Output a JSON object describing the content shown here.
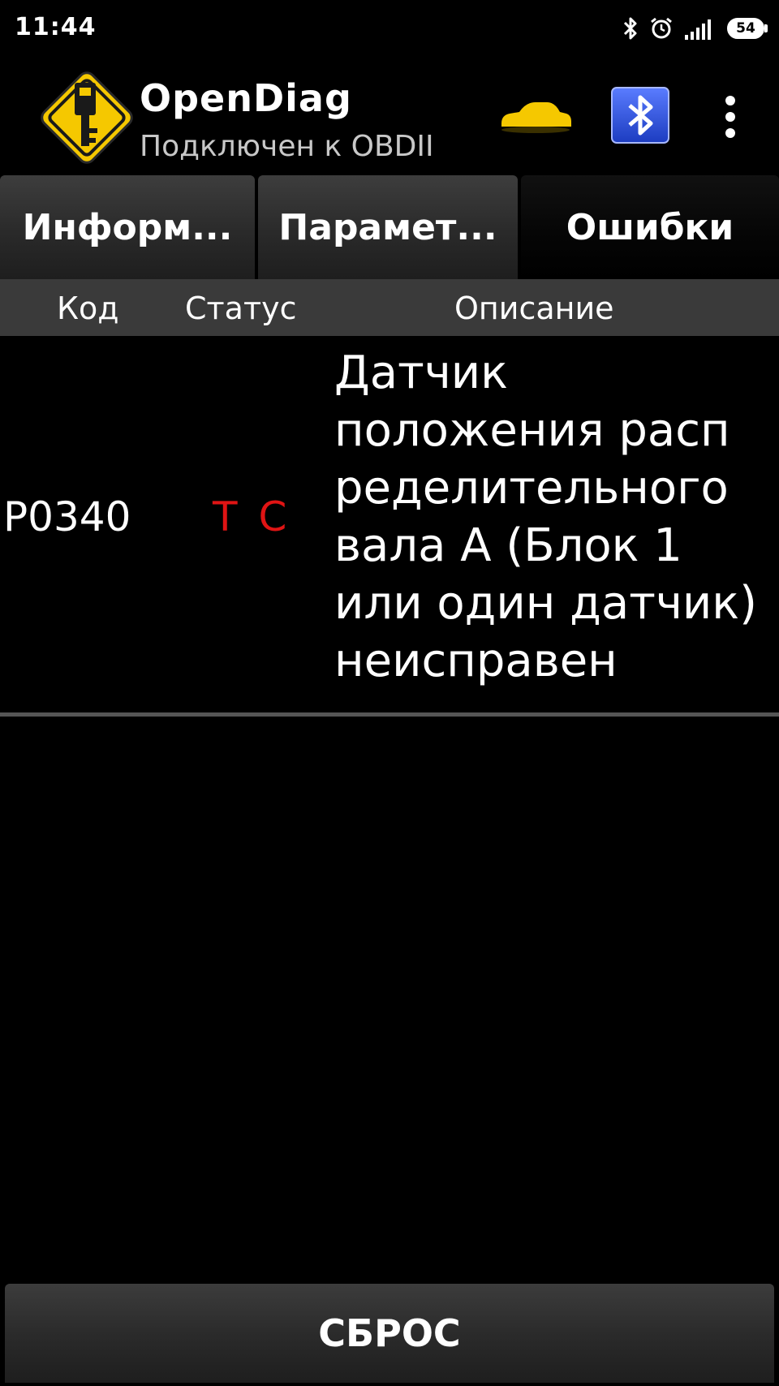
{
  "status_bar": {
    "time": "11:44",
    "battery": "54",
    "icons": [
      "bluetooth-icon",
      "alarm-icon",
      "signal-icon",
      "battery-icon"
    ]
  },
  "app_bar": {
    "title": "OpenDiag",
    "subtitle": "Подключен к OBDII",
    "icons": [
      "app-logo-icon",
      "car-icon",
      "bluetooth-icon",
      "overflow-menu-icon"
    ]
  },
  "tabs": [
    {
      "label": "Информ...",
      "active": false
    },
    {
      "label": "Парамет...",
      "active": false
    },
    {
      "label": "Ошибки",
      "active": true
    }
  ],
  "table": {
    "headers": {
      "code": "Код",
      "status": "Статус",
      "description": "Описание"
    },
    "rows": [
      {
        "code": "P0340",
        "status": [
          "T",
          "C"
        ],
        "description": "Датчик\nположения расп\nределительного\nвала А (Блок 1\nили один датчик)\nнеисправен"
      }
    ]
  },
  "reset_button": {
    "label": "СБРОС"
  },
  "colors": {
    "background": "#000000",
    "status_red": "#e01414",
    "accent_yellow": "#f5c800",
    "bluetooth_blue": "#1c44d0"
  }
}
